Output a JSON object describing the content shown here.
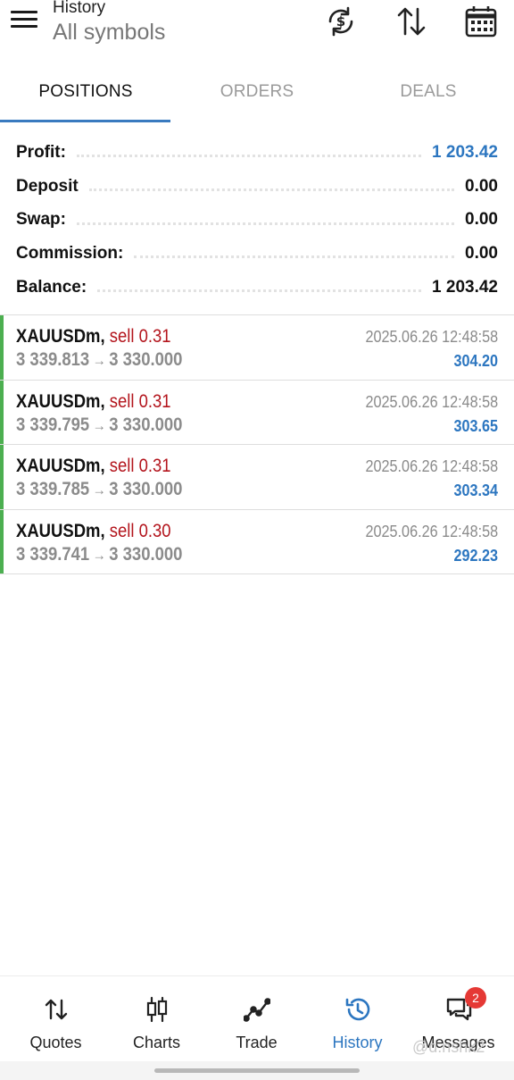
{
  "header": {
    "title_small": "History",
    "title_big": "All symbols",
    "icons": [
      "menu-icon",
      "currency-exchange-icon",
      "sort-icon",
      "calendar-icon"
    ]
  },
  "tabs": [
    {
      "label": "POSITIONS",
      "active": true
    },
    {
      "label": "ORDERS",
      "active": false
    },
    {
      "label": "DEALS",
      "active": false
    }
  ],
  "summary": [
    {
      "label": "Profit:",
      "value": "1 203.42"
    },
    {
      "label": "Deposit",
      "value": "0.00"
    },
    {
      "label": "Swap:",
      "value": "0.00"
    },
    {
      "label": "Commission:",
      "value": "0.00"
    },
    {
      "label": "Balance:",
      "value": "1 203.42"
    }
  ],
  "positions": [
    {
      "symbol": "XAUUSDm,",
      "type": "sell 0.31",
      "open": "3 339.813",
      "arrow": "→",
      "close": "3 330.000",
      "time": "2025.06.26 12:48:58",
      "profit": "304.20"
    },
    {
      "symbol": "XAUUSDm,",
      "type": "sell 0.31",
      "open": "3 339.795",
      "arrow": "→",
      "close": "3 330.000",
      "time": "2025.06.26 12:48:58",
      "profit": "303.65"
    },
    {
      "symbol": "XAUUSDm,",
      "type": "sell 0.31",
      "open": "3 339.785",
      "arrow": "→",
      "close": "3 330.000",
      "time": "2025.06.26 12:48:58",
      "profit": "303.34"
    },
    {
      "symbol": "XAUUSDm,",
      "type": "sell 0.30",
      "open": "3 339.741",
      "arrow": "→",
      "close": "3 330.000",
      "time": "2025.06.26 12:48:58",
      "profit": "292.23"
    }
  ],
  "colors": {
    "accent": "#2c76c0",
    "sell": "#b3141c",
    "position_bar": "#4caf50",
    "badge": "#e53935"
  },
  "bottom_nav": [
    {
      "label": "Quotes",
      "icon": "quotes-arrows-icon",
      "active": false
    },
    {
      "label": "Charts",
      "icon": "candlestick-icon",
      "active": false
    },
    {
      "label": "Trade",
      "icon": "trade-line-icon",
      "active": false
    },
    {
      "label": "History",
      "icon": "history-clock-icon",
      "active": true
    },
    {
      "label": "Messages",
      "icon": "chat-bubbles-icon",
      "active": false,
      "badge": "2"
    }
  ],
  "watermark": "@d.nshk2"
}
